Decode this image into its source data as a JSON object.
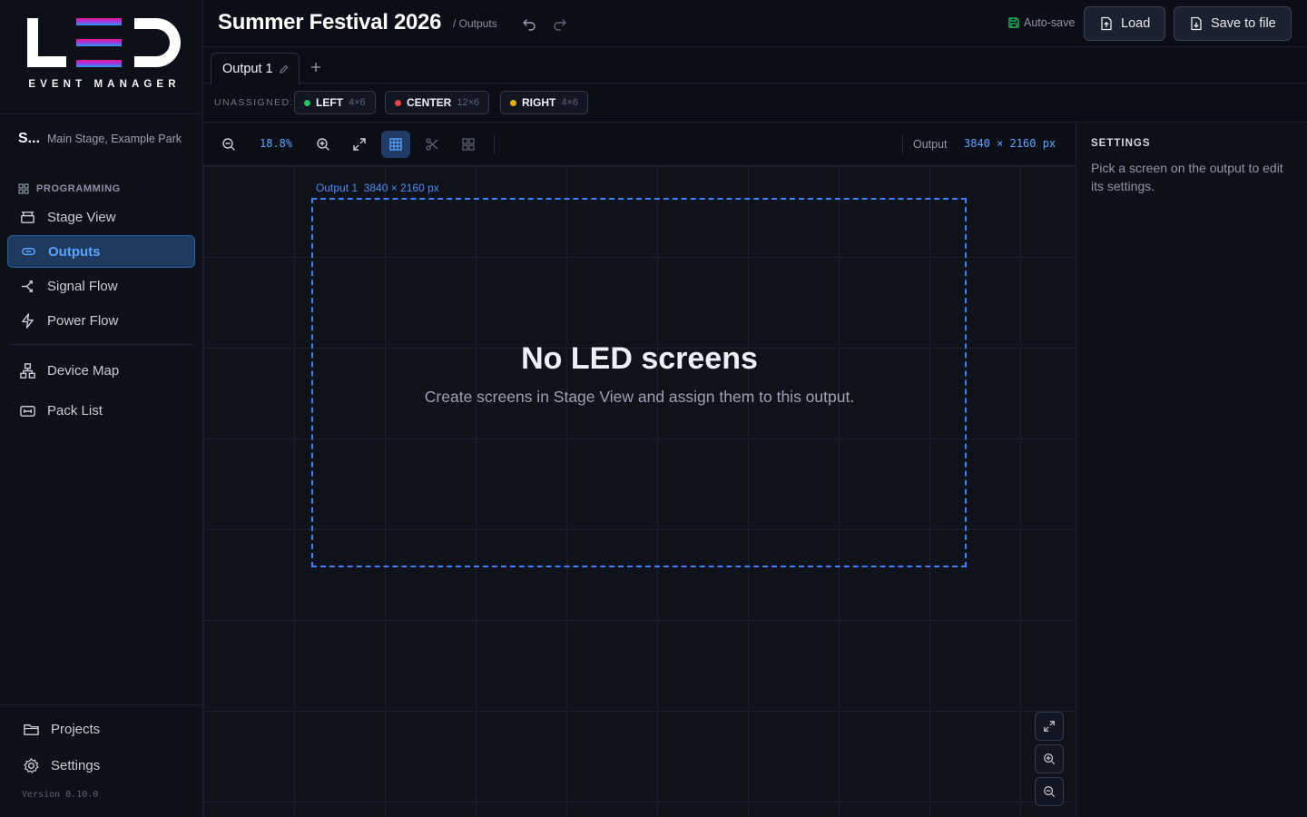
{
  "brand": {
    "tagline": "EVENT MANAGER"
  },
  "project": {
    "short_name": "S...",
    "venue": "Main Stage, Example Park"
  },
  "nav": {
    "section_label": "PROGRAMMING",
    "items": [
      {
        "label": "Stage View"
      },
      {
        "label": "Outputs"
      },
      {
        "label": "Signal Flow"
      },
      {
        "label": "Power Flow"
      },
      {
        "label": "Device Map"
      },
      {
        "label": "Pack List"
      }
    ],
    "bottom": [
      {
        "label": "Projects"
      },
      {
        "label": "Settings"
      }
    ],
    "version": "Version 0.10.0"
  },
  "header": {
    "title": "Summer Festival 2026",
    "breadcrumb": "/ Outputs",
    "autosave": "Auto-save",
    "load": "Load",
    "save": "Save to file"
  },
  "tabs": [
    {
      "label": "Output 1"
    }
  ],
  "unassigned": {
    "label": "UNASSIGNED:",
    "chips": [
      {
        "name": "LEFT",
        "dims": "4×6",
        "color": "#22c55e"
      },
      {
        "name": "CENTER",
        "dims": "12×6",
        "color": "#ef4444"
      },
      {
        "name": "RIGHT",
        "dims": "4×6",
        "color": "#eab308"
      }
    ]
  },
  "toolbar": {
    "zoom": "18.8%",
    "output_label": "Output",
    "output_dims": "3840 × 2160 px"
  },
  "canvas": {
    "frame_name": "Output 1",
    "frame_dims": "3840 × 2160 px",
    "empty_title": "No LED screens",
    "empty_subtitle": "Create screens in Stage View and assign them to this output."
  },
  "settings": {
    "title": "SETTINGS",
    "hint": "Pick a screen on the output to edit its settings."
  },
  "colors": {
    "accent": "#3b82f6",
    "active_nav_bg": "#1e3a5f",
    "autosave": "#22c55e"
  }
}
